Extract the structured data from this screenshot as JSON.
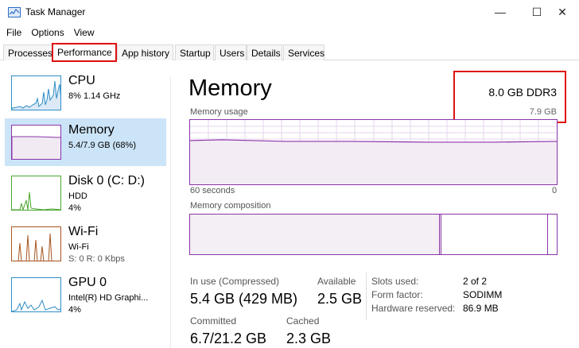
{
  "window": {
    "title": "Task Manager",
    "controls": {
      "minimize": "—",
      "maximize": "☐",
      "close": "✕"
    }
  },
  "menu": [
    "File",
    "Options",
    "View"
  ],
  "tabs": [
    {
      "label": "Processes",
      "active": false
    },
    {
      "label": "Performance",
      "active": true
    },
    {
      "label": "App history",
      "active": false
    },
    {
      "label": "Startup",
      "active": false
    },
    {
      "label": "Users",
      "active": false
    },
    {
      "label": "Details",
      "active": false
    },
    {
      "label": "Services",
      "active": false
    }
  ],
  "sidebar": {
    "items": [
      {
        "name": "CPU",
        "line1": "8%  1.14 GHz",
        "line2": "",
        "line3": "",
        "color": "#2f8dc6",
        "selected": false
      },
      {
        "name": "Memory",
        "line1": "5.4/7.9 GB (68%)",
        "line2": "",
        "line3": "",
        "color": "#8b34a8",
        "selected": true
      },
      {
        "name": "Disk 0 (C: D:)",
        "line1": "HDD",
        "line2": "4%",
        "line3": "",
        "color": "#4aa52e",
        "selected": false
      },
      {
        "name": "Wi-Fi",
        "line1": "Wi-Fi",
        "line2": "S: 0  R: 0 Kbps",
        "line3": "",
        "color": "#a7541e",
        "selected": false
      },
      {
        "name": "GPU 0",
        "line1": "Intel(R) HD Graphi...",
        "line2": "4%",
        "line3": "",
        "color": "#2f8dc6",
        "selected": false
      }
    ]
  },
  "main": {
    "title": "Memory",
    "total_spec": "8.0 GB DDR3",
    "usage_label": "Memory usage",
    "usage_max": "7.9 GB",
    "time_left": "60 seconds",
    "time_right": "0",
    "composition_label": "Memory composition",
    "usage_fraction": 0.68,
    "stats": {
      "in_use_label": "In use (Compressed)",
      "in_use_value": "5.4 GB (429 MB)",
      "available_label": "Available",
      "available_value": "2.5 GB",
      "committed_label": "Committed",
      "committed_value": "6.7/21.2 GB",
      "cached_label": "Cached",
      "cached_value": "2.3 GB"
    },
    "details": {
      "slots_label": "Slots used:",
      "slots_value": "2 of 2",
      "form_label": "Form factor:",
      "form_value": "SODIMM",
      "reserved_label": "Hardware reserved:",
      "reserved_value": "86.9 MB"
    }
  },
  "colors": {
    "memory": "#8b34a8",
    "cpu": "#2f8dc6",
    "disk": "#4aa52e",
    "wifi": "#a7541e",
    "highlight": "#e01010",
    "selected_bg": "#cce4f7"
  }
}
